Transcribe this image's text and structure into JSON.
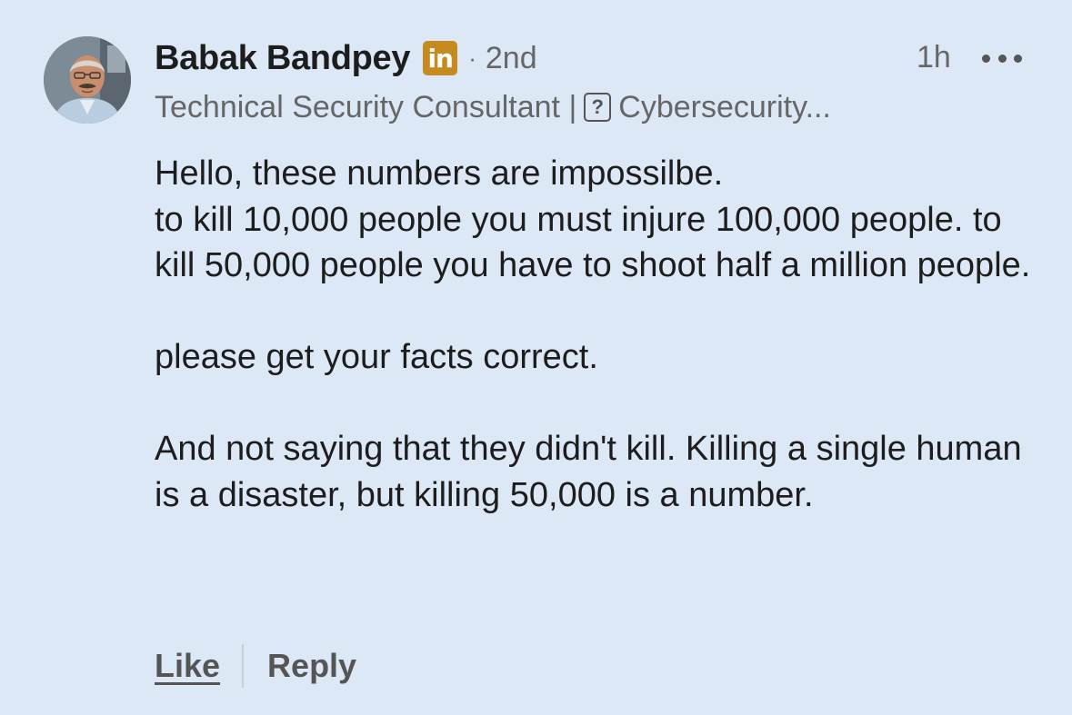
{
  "comment": {
    "author": {
      "name": "Babak Bandpey",
      "badge": "in",
      "separator": "·",
      "connection_degree": "2nd",
      "headline_prefix": "Technical Security Consultant |",
      "headline_glyph": "?",
      "headline_suffix": "Cybersecurity..."
    },
    "timestamp": "1h",
    "paragraphs": [
      "Hello, these numbers are impossilbe.",
      "to kill 10,000 people you must injure 100,000 people. to kill 50,000 people you have to shoot half a million people.",
      "please get your facts correct.",
      "And not saying that they didn't kill. Killing a single human is a disaster, but killing 50,000 is a number."
    ],
    "actions": {
      "like_label": "Like",
      "reply_label": "Reply"
    }
  },
  "icons": {
    "more": "more-horizontal-icon",
    "badge": "linkedin-icon",
    "avatar": "avatar-photo"
  },
  "colors": {
    "background": "#dde8f7",
    "badge": "#c68a1e",
    "secondary_text": "#666666"
  }
}
